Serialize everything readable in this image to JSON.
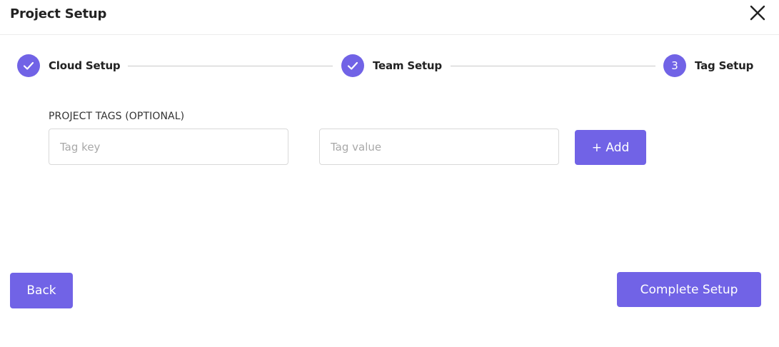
{
  "dialog": {
    "title": "Project Setup",
    "close_icon": "close-icon"
  },
  "stepper": {
    "steps": [
      {
        "label": "Cloud Setup",
        "state": "completed",
        "icon": "check-icon"
      },
      {
        "label": "Team Setup",
        "state": "completed",
        "icon": "check-icon"
      },
      {
        "label": "Tag Setup",
        "state": "active",
        "number": "3"
      }
    ]
  },
  "tags": {
    "section_label": "PROJECT TAGS (OPTIONAL)",
    "key_placeholder": "Tag key",
    "key_value": "",
    "value_placeholder": "Tag value",
    "value_value": "",
    "add_label": "+ Add"
  },
  "footer": {
    "back_label": "Back",
    "complete_label": "Complete Setup"
  },
  "colors": {
    "accent": "#7163e6",
    "connector": "#c9c9c9",
    "input_border": "#d9d9d9"
  }
}
